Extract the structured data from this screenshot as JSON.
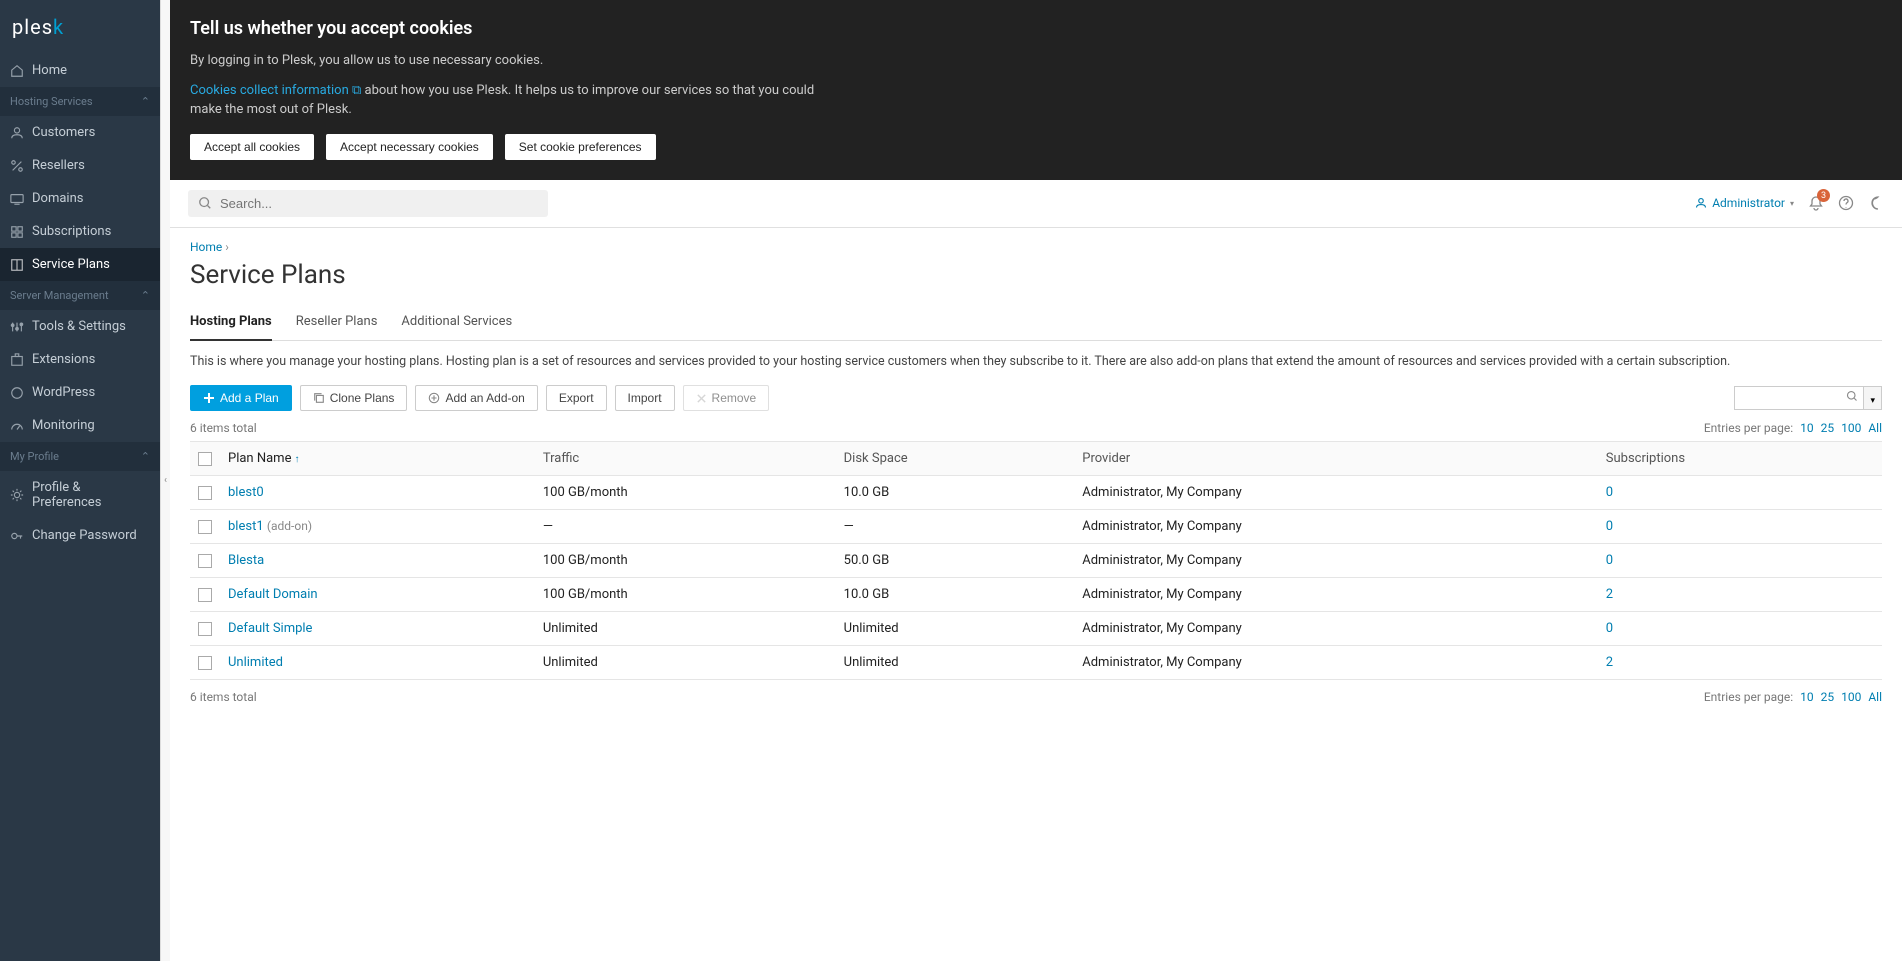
{
  "logo": {
    "text": "plesk"
  },
  "sidebar": {
    "items_top": [
      {
        "label": "Home"
      }
    ],
    "sections": [
      {
        "title": "Hosting Services",
        "items": [
          {
            "label": "Customers"
          },
          {
            "label": "Resellers"
          },
          {
            "label": "Domains"
          },
          {
            "label": "Subscriptions"
          },
          {
            "label": "Service Plans",
            "active": true
          }
        ]
      },
      {
        "title": "Server Management",
        "items": [
          {
            "label": "Tools & Settings"
          },
          {
            "label": "Extensions"
          },
          {
            "label": "WordPress"
          },
          {
            "label": "Monitoring"
          }
        ]
      },
      {
        "title": "My Profile",
        "items": [
          {
            "label": "Profile & Preferences"
          },
          {
            "label": "Change Password"
          }
        ]
      }
    ]
  },
  "cookie_banner": {
    "title": "Tell us whether you accept cookies",
    "line1": "By logging in to Plesk, you allow us to use necessary cookies.",
    "link_text": "Cookies collect information",
    "line2a": " about how you use Plesk. It helps us to improve our services so that you could make the most out of Plesk.",
    "btn_accept_all": "Accept all cookies",
    "btn_accept_necessary": "Accept necessary cookies",
    "btn_preferences": "Set cookie preferences"
  },
  "topbar": {
    "search_placeholder": "Search...",
    "user": "Administrator",
    "notification_count": "3"
  },
  "breadcrumb": {
    "home": "Home"
  },
  "page": {
    "title": "Service Plans"
  },
  "tabs": [
    {
      "label": "Hosting Plans",
      "active": true
    },
    {
      "label": "Reseller Plans"
    },
    {
      "label": "Additional Services"
    }
  ],
  "description": "This is where you manage your hosting plans. Hosting plan is a set of resources and services provided to your hosting service customers when they subscribe to it. There are also add-on plans that extend the amount of resources and services provided with a certain subscription.",
  "toolbar": {
    "add_plan": "Add a Plan",
    "clone": "Clone Plans",
    "add_addon": "Add an Add-on",
    "export": "Export",
    "import": "Import",
    "remove": "Remove"
  },
  "table": {
    "total_label_top": "6 items total",
    "total_label_bottom": "6 items total",
    "pager_label": "Entries per page:",
    "pager_options": [
      "10",
      "25",
      "100",
      "All"
    ],
    "columns": {
      "name": "Plan Name",
      "traffic": "Traffic",
      "disk": "Disk Space",
      "provider": "Provider",
      "subs": "Subscriptions"
    },
    "rows": [
      {
        "name": "blest0",
        "addon": "",
        "traffic": "100 GB/month",
        "disk": "10.0 GB",
        "provider": "Administrator, My Company",
        "subs": "0"
      },
      {
        "name": "blest1",
        "addon": "(add-on)",
        "traffic": "—",
        "disk": "—",
        "provider": "Administrator, My Company",
        "subs": "0"
      },
      {
        "name": "Blesta",
        "addon": "",
        "traffic": "100 GB/month",
        "disk": "50.0 GB",
        "provider": "Administrator, My Company",
        "subs": "0"
      },
      {
        "name": "Default Domain",
        "addon": "",
        "traffic": "100 GB/month",
        "disk": "10.0 GB",
        "provider": "Administrator, My Company",
        "subs": "2"
      },
      {
        "name": "Default Simple",
        "addon": "",
        "traffic": "Unlimited",
        "disk": "Unlimited",
        "provider": "Administrator, My Company",
        "subs": "0"
      },
      {
        "name": "Unlimited",
        "addon": "",
        "traffic": "Unlimited",
        "disk": "Unlimited",
        "provider": "Administrator, My Company",
        "subs": "2"
      }
    ]
  }
}
